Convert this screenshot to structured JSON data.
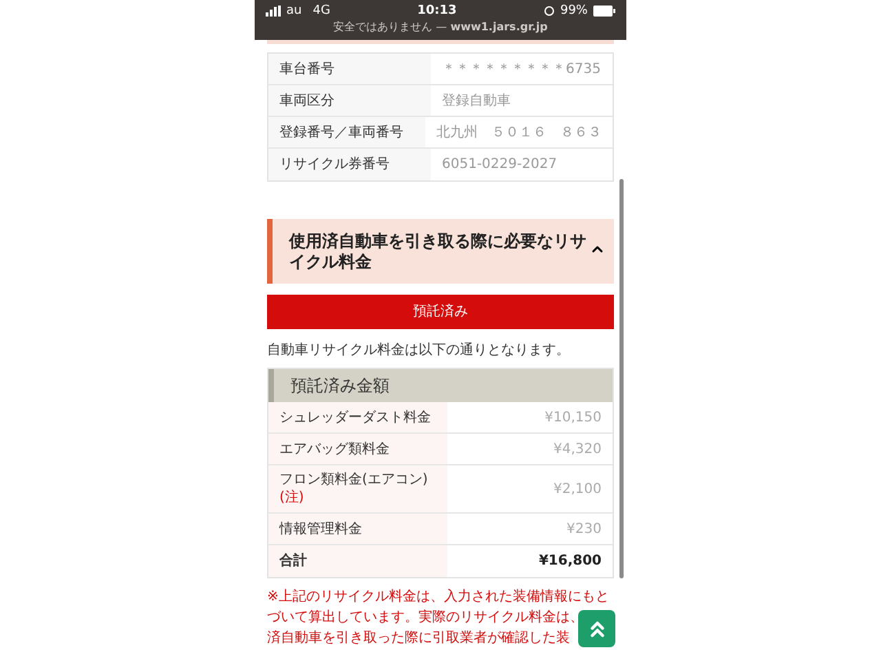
{
  "status_bar": {
    "carrier": "au",
    "network": "4G",
    "time": "10:13",
    "battery": "99%"
  },
  "address_bar": {
    "text": "安全ではありません — **www1.jars.gr.jp**"
  },
  "vehicle_table": {
    "rows": [
      {
        "label": "車台番号",
        "value": "＊＊＊＊＊＊＊＊＊6735"
      },
      {
        "label": "車両区分",
        "value": "登録自動車"
      },
      {
        "label": "登録番号／車両番号",
        "value": "北九州　５０１６　８６３"
      },
      {
        "label": "リサイクル券番号",
        "value": "6051-0229-2027"
      }
    ]
  },
  "section": {
    "title": "使用済自動車を引き取る際に必要なリサイクル料金",
    "expanded": true
  },
  "status_button": "預託済み",
  "intro": "自動車リサイクル料金は以下の通りとなります。",
  "fee_table": {
    "heading": "預託済み金額",
    "rows": [
      {
        "kind": "item",
        "label": "シュレッダーダスト料金",
        "value": "¥10,150"
      },
      {
        "kind": "item",
        "label": "エアバッグ類料金",
        "value": "¥4,320"
      },
      {
        "kind": "item",
        "label": "フロン類料金(エアコン)",
        "note": "(注)",
        "value": "¥2,100"
      },
      {
        "kind": "item",
        "label": "情報管理料金",
        "value": "¥230"
      },
      {
        "kind": "total",
        "label": "合計",
        "value": "¥16,800"
      }
    ]
  },
  "note": [
    "※上記のリサイクル料金は、入力された装備情報にもと",
    "づいて算出しています。実際のリサイクル料金は、",
    "済自動車を引き取った際に引取業者が確認した装"
  ]
}
